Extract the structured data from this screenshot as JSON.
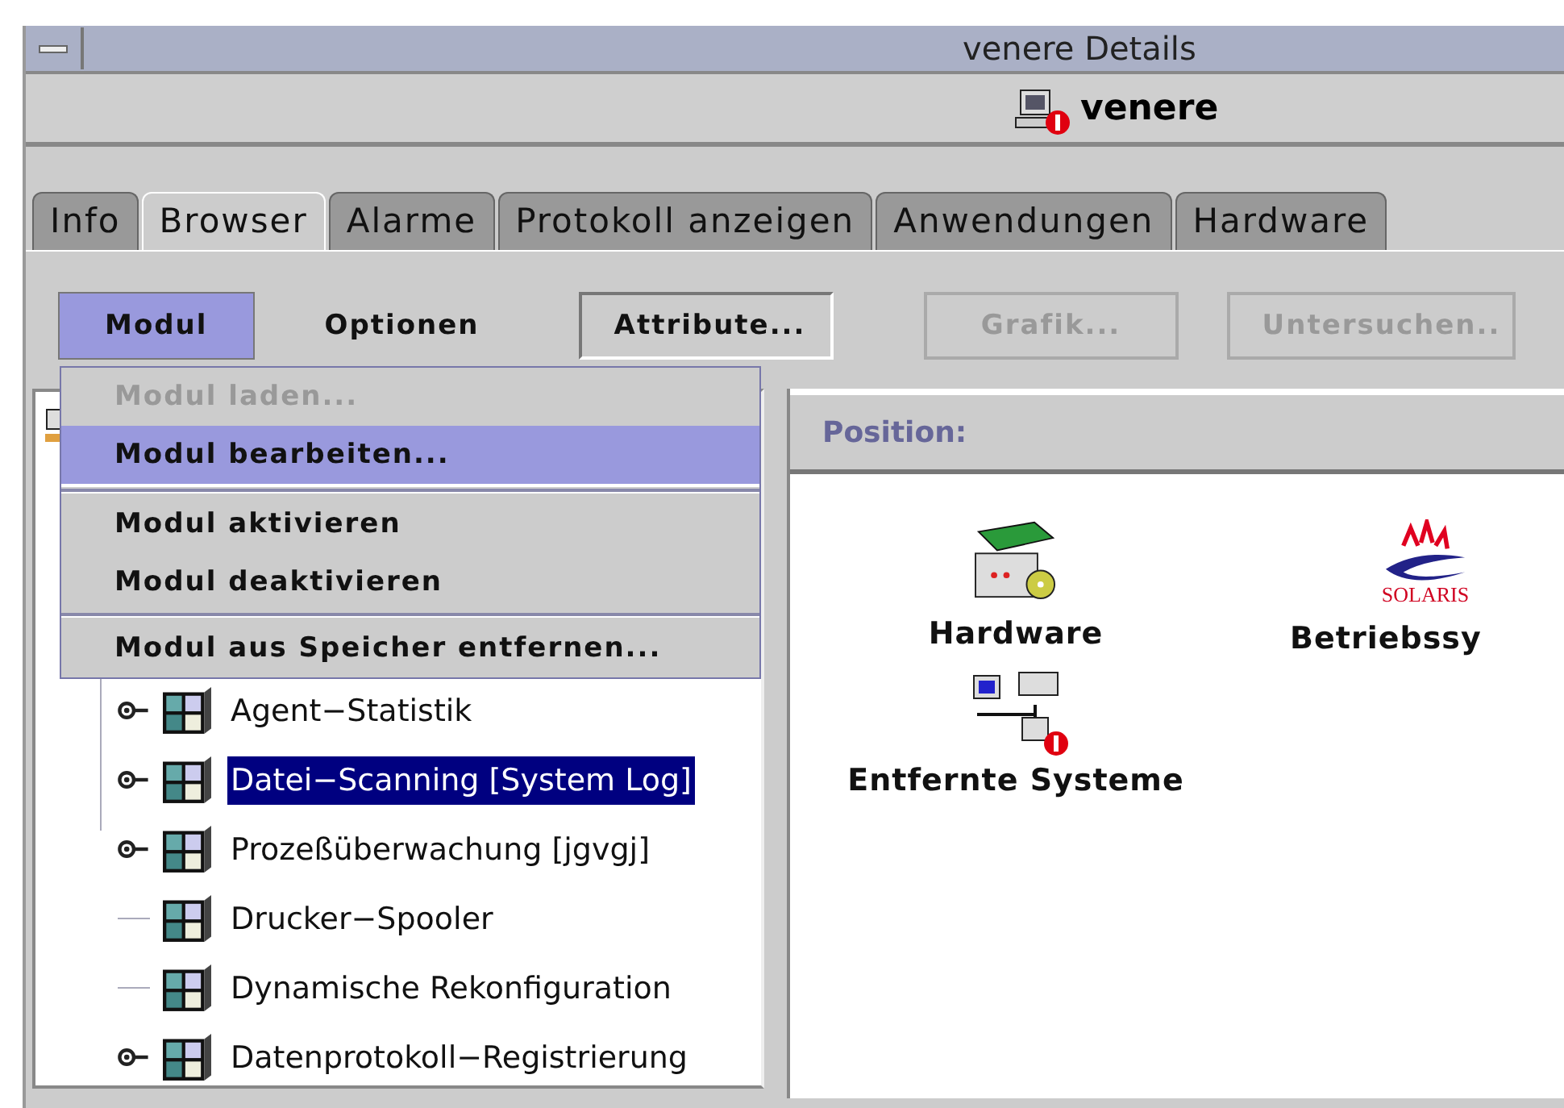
{
  "window": {
    "title": "venere Details"
  },
  "header": {
    "host": "venere",
    "alert": true
  },
  "tabs": [
    {
      "label": "Info",
      "selected": false
    },
    {
      "label": "Browser",
      "selected": true
    },
    {
      "label": "Alarme",
      "selected": false
    },
    {
      "label": "Protokoll anzeigen",
      "selected": false
    },
    {
      "label": "Anwendungen",
      "selected": false
    },
    {
      "label": "Hardware",
      "selected": false
    }
  ],
  "toolbar": [
    {
      "kind": "menu",
      "label": "Modul",
      "selected": true,
      "disabled": false
    },
    {
      "kind": "menu",
      "label": "Optionen",
      "selected": false,
      "disabled": false
    },
    {
      "kind": "button",
      "label": "Attribute...",
      "selected": false,
      "disabled": false
    },
    {
      "kind": "button",
      "label": "Grafik...",
      "selected": false,
      "disabled": true
    },
    {
      "kind": "button",
      "label": "Untersuchen..",
      "selected": false,
      "disabled": true
    }
  ],
  "menu": [
    {
      "kind": "item",
      "label": "Modul laden...",
      "disabled": true,
      "selected": false
    },
    {
      "kind": "item",
      "label": "Modul bearbeiten...",
      "disabled": false,
      "selected": true
    },
    {
      "kind": "separator"
    },
    {
      "kind": "item",
      "label": "Modul aktivieren",
      "disabled": false,
      "selected": false
    },
    {
      "kind": "item",
      "label": "Modul deaktivieren",
      "disabled": false,
      "selected": false
    },
    {
      "kind": "separator"
    },
    {
      "kind": "item",
      "label": "Modul aus Speicher entfernen...",
      "disabled": false,
      "selected": false
    }
  ],
  "tree": {
    "items": [
      {
        "label": "Agent−Statistik",
        "expandable": true,
        "selected": false
      },
      {
        "label": "Datei−Scanning [System Log]",
        "expandable": true,
        "selected": true
      },
      {
        "label": "Prozeßüberwachung [jgvgj]",
        "expandable": true,
        "selected": false
      },
      {
        "label": "Drucker−Spooler",
        "expandable": false,
        "selected": false
      },
      {
        "label": "Dynamische Rekonfiguration",
        "expandable": false,
        "selected": false
      },
      {
        "label": "Datenprotokoll−Registrierung",
        "expandable": true,
        "selected": false
      }
    ]
  },
  "browser": {
    "position_label": "Position:",
    "items": [
      {
        "kind": "hardware",
        "label": "Hardware",
        "alert": false
      },
      {
        "kind": "solaris",
        "label": "Betriebssy",
        "logo_text": "SOLARIS",
        "alert": false
      },
      {
        "kind": "network",
        "label": "Entfernte Systeme",
        "alert": true
      }
    ]
  }
}
